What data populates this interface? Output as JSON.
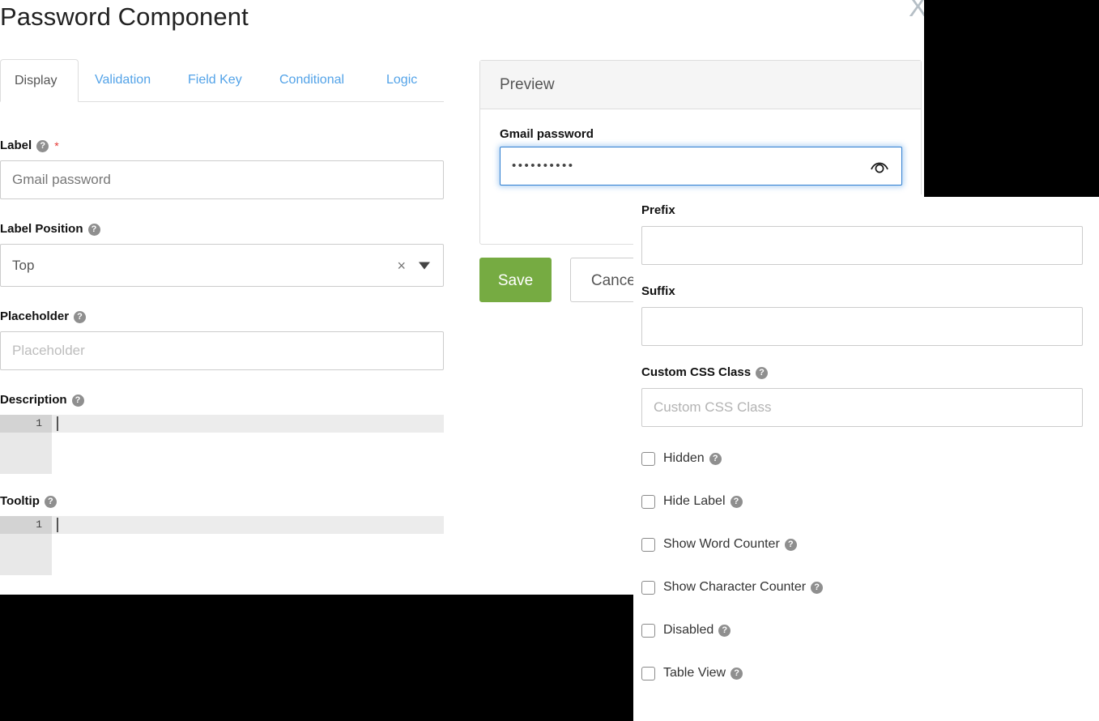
{
  "dialog": {
    "title": "Password Component",
    "close_label": "X"
  },
  "tabs": [
    {
      "label": "Display",
      "active": true
    },
    {
      "label": "Validation",
      "active": false
    },
    {
      "label": "Field Key",
      "active": false
    },
    {
      "label": "Conditional",
      "active": false
    },
    {
      "label": "Logic",
      "active": false
    }
  ],
  "display_form": {
    "label_field": {
      "label": "Label",
      "required_marker": "*",
      "help": "?",
      "value": "Gmail password"
    },
    "label_position": {
      "label": "Label Position",
      "help": "?",
      "selected": "Top",
      "clear_icon": "×"
    },
    "placeholder_field": {
      "label": "Placeholder",
      "help": "?",
      "value": "",
      "placeholder": "Placeholder"
    },
    "description_field": {
      "label": "Description",
      "help": "?",
      "line_number": "1",
      "value": ""
    },
    "tooltip_field": {
      "label": "Tooltip",
      "help": "?",
      "line_number": "1",
      "value": ""
    }
  },
  "preview": {
    "header": "Preview",
    "field_label": "Gmail password",
    "masked_value": "••••••••••",
    "eye_icon": "eye-icon"
  },
  "actions": {
    "save_label": "Save",
    "cancel_label": "Cancel",
    "save_color": "#76ab42"
  },
  "overlay_panel": {
    "prefix": {
      "label": "Prefix",
      "value": "",
      "placeholder": ""
    },
    "suffix": {
      "label": "Suffix",
      "value": "",
      "placeholder": ""
    },
    "custom_css_class": {
      "label": "Custom CSS Class",
      "help": "?",
      "value": "",
      "placeholder": "Custom CSS Class"
    },
    "checkboxes": [
      {
        "label": "Hidden",
        "help": "?",
        "checked": false
      },
      {
        "label": "Hide Label",
        "help": "?",
        "checked": false
      },
      {
        "label": "Show Word Counter",
        "help": "?",
        "checked": false
      },
      {
        "label": "Show Character Counter",
        "help": "?",
        "checked": false
      },
      {
        "label": "Disabled",
        "help": "?",
        "checked": false
      },
      {
        "label": "Table View",
        "help": "?",
        "checked": false
      }
    ]
  }
}
